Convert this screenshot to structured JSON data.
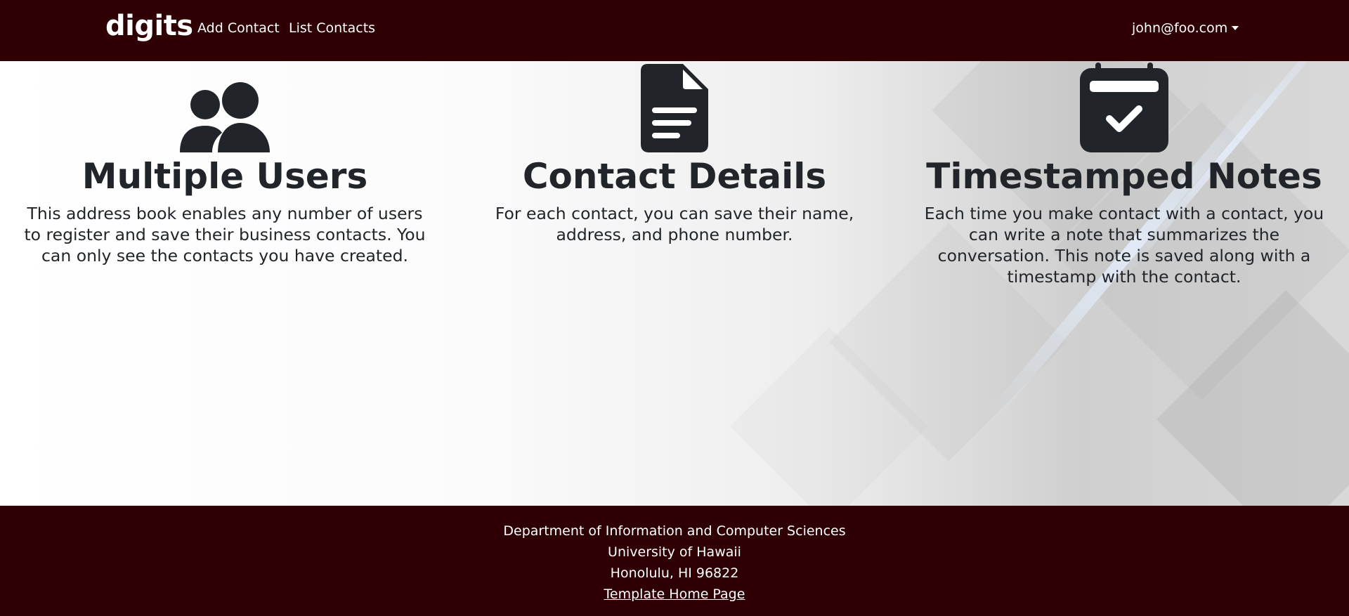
{
  "navbar": {
    "brand": "digits",
    "links": [
      {
        "label": "Add Contact"
      },
      {
        "label": "List Contacts"
      }
    ],
    "user": "john@foo.com",
    "bg_color": "#2f0003"
  },
  "features": [
    {
      "icon": "users-icon",
      "title": "Multiple Users",
      "text": "This address book enables any number of users to register and save their business contacts. You can only see the contacts you have created."
    },
    {
      "icon": "file-text-icon",
      "title": "Contact Details",
      "text": "For each contact, you can save their name, address, and phone number."
    },
    {
      "icon": "calendar-check-icon",
      "title": "Timestamped Notes",
      "text": "Each time you make contact with a contact, you can write a note that summarizes the conversation. This note is saved along with a timestamp with the contact."
    }
  ],
  "footer": {
    "lines": [
      "Department of Information and Computer Sciences",
      "University of Hawaii",
      "Honolulu, HI 96822"
    ],
    "link": "Template Home Page"
  }
}
